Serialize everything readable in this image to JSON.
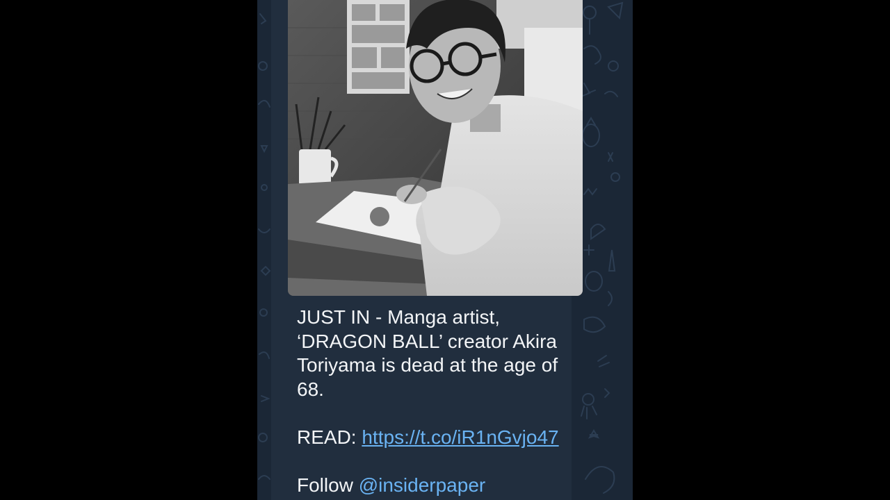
{
  "message": {
    "line1": "JUST IN - Manga artist, ‘DRAGON BALL’ creator Akira Toriyama is dead at the age of 68.",
    "read_label": "READ:",
    "read_link": "https://t.co/iR1nGvjo47",
    "follow_label": "Follow",
    "follow_handle": "@insiderpaper"
  },
  "colors": {
    "chat_background": "#1b2736",
    "bubble": "#212e3e",
    "link": "#6ab3f3",
    "text": "#f3f5f7"
  },
  "icons": [
    "chat-doodle-pattern"
  ]
}
